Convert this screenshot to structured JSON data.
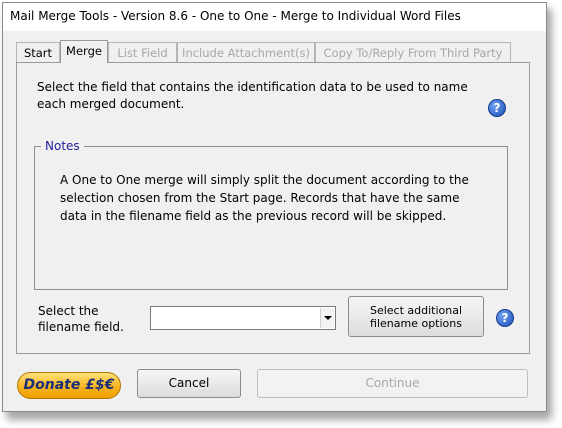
{
  "window": {
    "title": "Mail Merge Tools - Version 8.6 - One to One - Merge to Individual Word Files"
  },
  "tabs": [
    {
      "label": "Start",
      "state": "normal"
    },
    {
      "label": "Merge",
      "state": "active"
    },
    {
      "label": "List Field",
      "state": "disabled"
    },
    {
      "label": "Include Attachment(s)",
      "state": "disabled"
    },
    {
      "label": "Copy To/Reply From Third Party",
      "state": "disabled"
    }
  ],
  "merge_panel": {
    "instruction": "Select the field that contains the identification data to be used to name each merged document.",
    "help_glyph": "?",
    "notes": {
      "legend": "Notes",
      "text": "A One to One merge will simply split the document according to the selection chosen from the Start page. Records that have the same data in the filename field as the previous record will be skipped."
    },
    "filename_field": {
      "label": "Select the filename field.",
      "value": ""
    },
    "additional_options_button": "Select additional filename options"
  },
  "footer": {
    "donate_label": "Donate £$€",
    "cancel_label": "Cancel",
    "continue_label": "Continue"
  },
  "colors": {
    "notes_legend": "#1f1f9e",
    "donate_fill": "#f5b321",
    "donate_text": "#1a2f7a",
    "help_icon": "#1b4fb8",
    "disabled_text": "#a8a8a8"
  }
}
